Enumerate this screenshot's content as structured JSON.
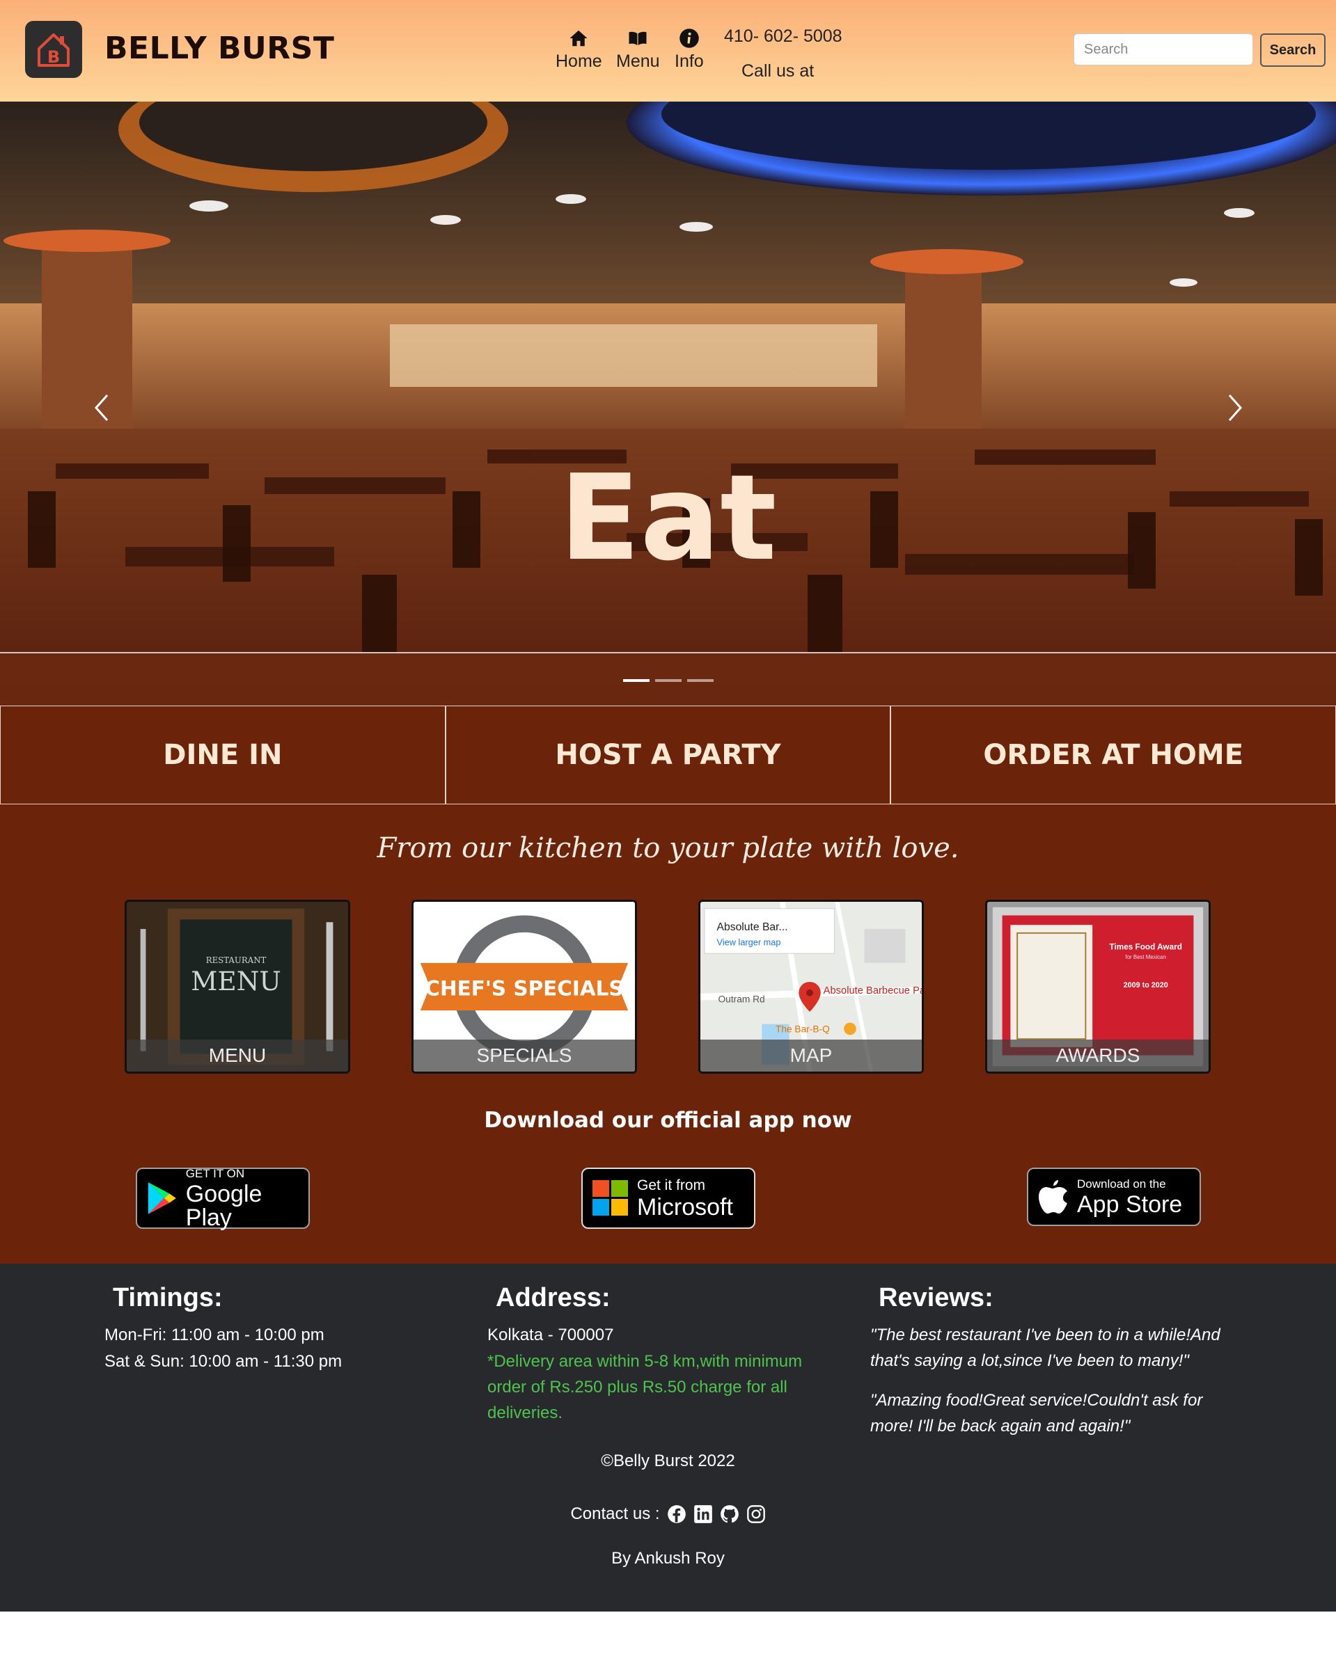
{
  "navbar": {
    "brand": "BELLY BURST",
    "logo_icon": "house-b-logo-icon",
    "items": [
      {
        "label": "Home",
        "icon": "home-icon"
      },
      {
        "label": "Menu",
        "icon": "book-icon"
      },
      {
        "label": "Info",
        "icon": "info-icon"
      }
    ],
    "phone": "410- 602- 5008",
    "call_us": "Call us at",
    "search_placeholder": "Search",
    "search_button": "Search"
  },
  "hero": {
    "title": "Eat",
    "indicators": 3,
    "active_indicator": 0
  },
  "cta": [
    "DINE IN",
    "HOST A PARTY",
    "ORDER AT HOME"
  ],
  "main": {
    "tagline": "From our kitchen to your plate with love.",
    "cards": [
      {
        "label": "MENU",
        "image_text": "MENU",
        "image_small": "RESTAURANT"
      },
      {
        "label": "SPECIALS",
        "image_text": "CHEF'S SPECIALS"
      },
      {
        "label": "MAP",
        "map_title": "Absolute Bar...",
        "map_link": "View larger map",
        "map_place": "Absolute Barbecue Park Street",
        "map_road": "Outram Rd",
        "map_poi": "The Bar-B-Q"
      },
      {
        "label": "AWARDS",
        "award_title": "Times Food Award",
        "award_subtitle": "for Best Mexican",
        "award_years": "2009 to 2020"
      }
    ],
    "download_text": "Download our official app now",
    "stores": [
      {
        "small": "GET IT ON",
        "big": "Google Play",
        "icon": "google-play-icon"
      },
      {
        "small": "Get it from",
        "big": "Microsoft",
        "icon": "microsoft-icon"
      },
      {
        "small": "Download on the",
        "big": "App Store",
        "icon": "apple-icon"
      }
    ]
  },
  "footer": {
    "timings_title": "Timings:",
    "timings": [
      "Mon-Fri: 11:00 am - 10:00 pm",
      "Sat & Sun: 10:00 am - 11:30 pm"
    ],
    "address_title": "Address:",
    "address": "Kolkata - 700007",
    "delivery_note": "*Delivery area within 5-8 km,with minimum order of Rs.250 plus Rs.50 charge for all deliveries.",
    "reviews_title": "Reviews:",
    "reviews": [
      "\"The best restaurant I've been to in a while!And that's saying a lot,since I've been to many!\"",
      "\"Amazing food!Great service!Couldn't ask for more! I'll be back again and again!\""
    ],
    "copyright": "©Belly Burst 2022",
    "contact_label": "Contact us :",
    "contact_icons": [
      "facebook-icon",
      "linkedin-icon",
      "github-icon",
      "instagram-icon"
    ],
    "author": "By Ankush Roy"
  },
  "colors": {
    "navbar_gradient_top": "#fbb077",
    "navbar_gradient_bottom": "#fdd59a",
    "main_brown": "#6b2409",
    "footer_dark": "#27292c",
    "delivery_green": "#4ec34e",
    "hero_text": "#fde6cf"
  }
}
